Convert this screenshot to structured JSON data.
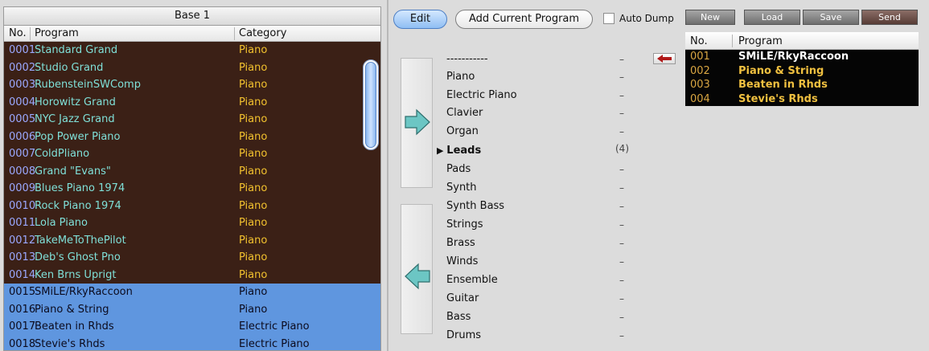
{
  "left_panel": {
    "title": "Base 1",
    "columns": {
      "no": "No.",
      "program": "Program",
      "category": "Category"
    },
    "rows": [
      {
        "no": "0001",
        "program": "Standard Grand",
        "category": "Piano",
        "state": "dark"
      },
      {
        "no": "0002",
        "program": "Studio Grand",
        "category": "Piano",
        "state": "dark"
      },
      {
        "no": "0003",
        "program": "RubensteinSWComp",
        "category": "Piano",
        "state": "dark"
      },
      {
        "no": "0004",
        "program": "Horowitz Grand",
        "category": "Piano",
        "state": "dark"
      },
      {
        "no": "0005",
        "program": "NYC Jazz Grand",
        "category": "Piano",
        "state": "dark"
      },
      {
        "no": "0006",
        "program": "Pop Power Piano",
        "category": "Piano",
        "state": "dark"
      },
      {
        "no": "0007",
        "program": "ColdPliano",
        "category": "Piano",
        "state": "dark"
      },
      {
        "no": "0008",
        "program": "Grand  \"Evans\"",
        "category": "Piano",
        "state": "dark"
      },
      {
        "no": "0009",
        "program": "Blues Piano 1974",
        "category": "Piano",
        "state": "dark"
      },
      {
        "no": "0010",
        "program": "Rock Piano 1974",
        "category": "Piano",
        "state": "dark"
      },
      {
        "no": "0011",
        "program": "Lola Piano",
        "category": "Piano",
        "state": "dark"
      },
      {
        "no": "0012",
        "program": "TakeMeToThePilot",
        "category": "Piano",
        "state": "dark"
      },
      {
        "no": "0013",
        "program": "Deb's  Ghost Pno",
        "category": "Piano",
        "state": "dark"
      },
      {
        "no": "0014",
        "program": "Ken Brns Uprigt",
        "category": "Piano",
        "state": "dark"
      },
      {
        "no": "0015",
        "program": "SMiLE/RkyRaccoon",
        "category": "Piano",
        "state": "selected"
      },
      {
        "no": "0016",
        "program": "Piano & String",
        "category": "Piano",
        "state": "selected"
      },
      {
        "no": "0017",
        "program": "Beaten in Rhds",
        "category": "Electric Piano",
        "state": "selected"
      },
      {
        "no": "0018",
        "program": "Stevie's Rhds",
        "category": "Electric Piano",
        "state": "selected"
      }
    ]
  },
  "toolbar": {
    "edit_label": "Edit",
    "add_current_label": "Add Current Program",
    "auto_dump_label": "Auto Dump"
  },
  "categories": [
    {
      "label": "-----------",
      "count": "–"
    },
    {
      "label": "Piano",
      "count": "–"
    },
    {
      "label": "Electric Piano",
      "count": "–"
    },
    {
      "label": "Clavier",
      "count": "–"
    },
    {
      "label": "Organ",
      "count": "–"
    },
    {
      "label": "Leads",
      "count": "(4)",
      "active": true
    },
    {
      "label": "Pads",
      "count": "–"
    },
    {
      "label": "Synth",
      "count": "–"
    },
    {
      "label": "Synth Bass",
      "count": "–"
    },
    {
      "label": "Strings",
      "count": "–"
    },
    {
      "label": "Brass",
      "count": "–"
    },
    {
      "label": "Winds",
      "count": "–"
    },
    {
      "label": "Ensemble",
      "count": "–"
    },
    {
      "label": "Guitar",
      "count": "–"
    },
    {
      "label": "Bass",
      "count": "–"
    },
    {
      "label": "Drums",
      "count": "–"
    }
  ],
  "right_buttons": {
    "new": "New",
    "load": "Load",
    "save": "Save",
    "send": "Send"
  },
  "right_table": {
    "columns": {
      "no": "No.",
      "program": "Program"
    },
    "rows": [
      {
        "no": "001",
        "program": "SMiLE/RkyRaccoon",
        "selected": true
      },
      {
        "no": "002",
        "program": "Piano & String"
      },
      {
        "no": "003",
        "program": "Beaten in Rhds"
      },
      {
        "no": "004",
        "program": "Stevie's Rhds"
      }
    ]
  },
  "icons": {
    "right_arrow": "arrow-right-icon",
    "left_arrow": "arrow-left-icon",
    "red_arrow": "arrow-left-red-icon",
    "active_marker": "triangle-right-icon"
  },
  "colors": {
    "dark_row": "#3b2016",
    "selected_row": "#5f96df",
    "row_number": "#9aa8ff",
    "row_name": "#7fe0d8",
    "row_category": "#f2c12e",
    "arrow_fill": "#6cc6c4",
    "red_arrow": "#b01818"
  }
}
